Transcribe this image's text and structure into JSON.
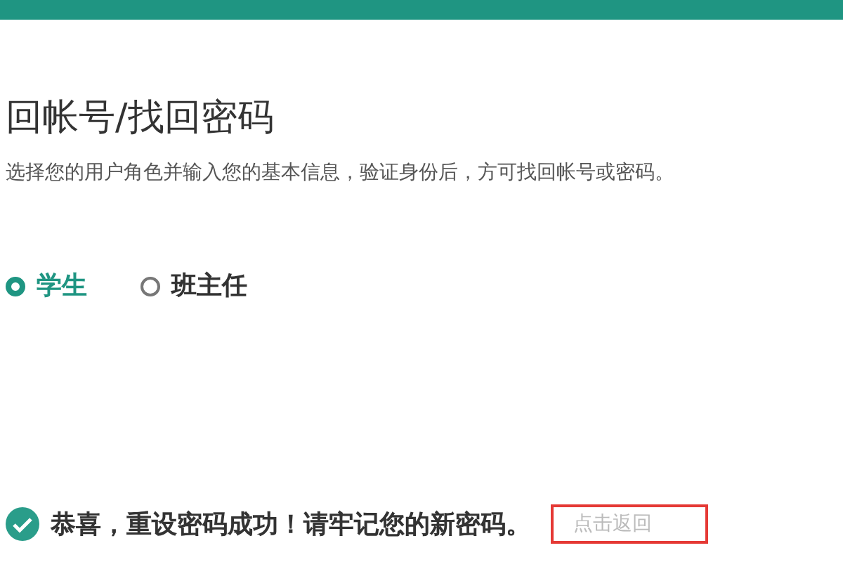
{
  "title": "回帐号/找回密码",
  "description": "选择您的用户角色并输入您的基本信息，验证身份后，方可找回帐号或密码。",
  "roles": [
    {
      "label": "学生",
      "selected": true
    },
    {
      "label": "班主任",
      "selected": false
    }
  ],
  "success": {
    "message": "恭喜，重设密码成功！请牢记您的新密码。",
    "link": "点击返回"
  }
}
